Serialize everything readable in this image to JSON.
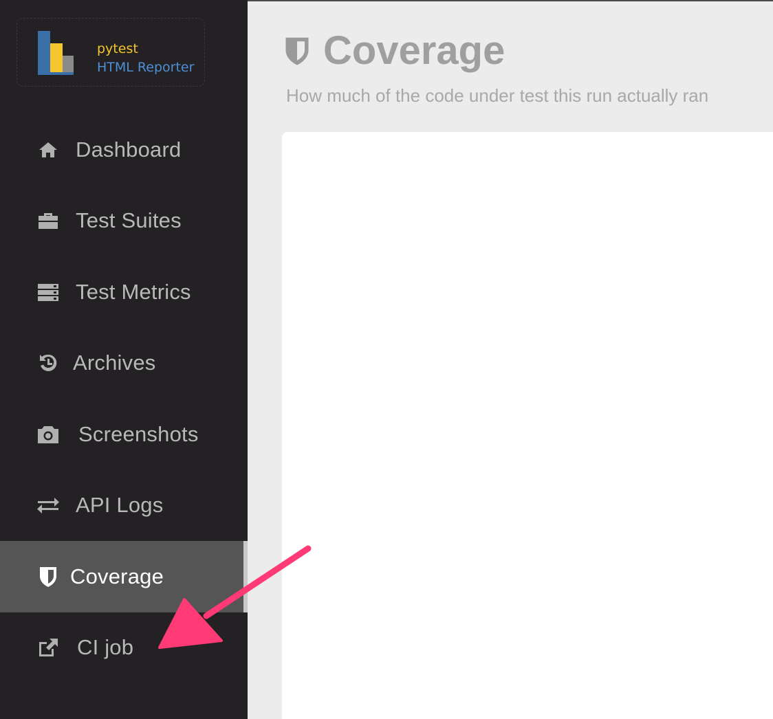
{
  "logo": {
    "line1": "pytest",
    "line2": "HTML Reporter",
    "colors": {
      "blue": "#3a6fa8",
      "yellow": "#f4c62c",
      "gray": "#8a8a8a"
    }
  },
  "sidebar": {
    "items": [
      {
        "label": "Dashboard",
        "icon": "home-icon",
        "active": false
      },
      {
        "label": "Test Suites",
        "icon": "briefcase-icon",
        "active": false
      },
      {
        "label": "Test Metrics",
        "icon": "server-icon",
        "active": false
      },
      {
        "label": "Archives",
        "icon": "history-icon",
        "active": false
      },
      {
        "label": "Screenshots",
        "icon": "camera-icon",
        "active": false
      },
      {
        "label": "API Logs",
        "icon": "exchange-icon",
        "active": false
      },
      {
        "label": "Coverage",
        "icon": "shield-icon",
        "active": true
      },
      {
        "label": "CI job",
        "icon": "external-link-icon",
        "active": false
      }
    ]
  },
  "header": {
    "title": "Coverage",
    "subtitle": "How much of the code under test this run actually ran",
    "icon": "shield-icon"
  },
  "annotation": {
    "arrow_color": "#ff3a75"
  }
}
